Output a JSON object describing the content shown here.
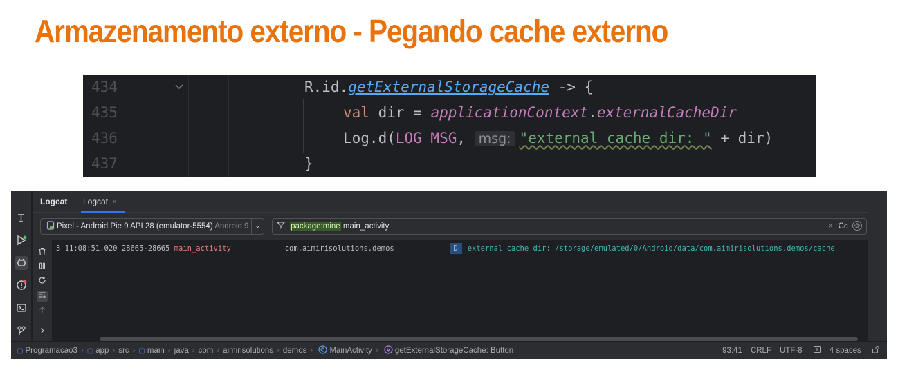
{
  "slide": {
    "title": "Armazenamento externo - Pegando cache externo"
  },
  "code": {
    "lines": [
      {
        "number": "434",
        "code_tokens": [
          "R.id.",
          "getExternalStorageCache",
          " -> {"
        ]
      },
      {
        "number": "435",
        "code_tokens": [
          "val",
          " dir = ",
          "applicationContext",
          ".",
          "externalCacheDir"
        ]
      },
      {
        "number": "436",
        "code_tokens": [
          "Log.d(",
          "LOG_MSG",
          ", ",
          "msg:",
          "\"external cache dir: \"",
          " + dir)"
        ]
      },
      {
        "number": "437",
        "code_tokens": [
          "}"
        ]
      }
    ]
  },
  "ide": {
    "tool_title": "Logcat",
    "tab_label": "Logcat",
    "tab_close": "×",
    "device": {
      "name": "Pixel - Android Pie 9 API 28 (emulator-5554)",
      "suffix": "Android 9"
    },
    "filter": {
      "key": "package:mine",
      "rest": " main_activity",
      "clear": "×",
      "case": "Cc",
      "star": "☆"
    },
    "help": "?",
    "log": {
      "prefix": "3 11:08:51.020 28665-28665 ",
      "tag": "main_activity",
      "package": "com.aimirisolutions.demos",
      "level": "D",
      "message": "external cache dir: /storage/emulated/0/Android/data/com.aimirisolutions.demos/cache"
    },
    "breadcrumbs": [
      "Programacao3",
      "app",
      "src",
      "main",
      "java",
      "com",
      "aimirisolutions",
      "demos",
      "MainActivity",
      "getExternalStorageCache: Button"
    ],
    "status": {
      "position": "93:41",
      "line_sep": "CRLF",
      "encoding": "UTF-8",
      "indent": "4 spaces"
    }
  }
}
